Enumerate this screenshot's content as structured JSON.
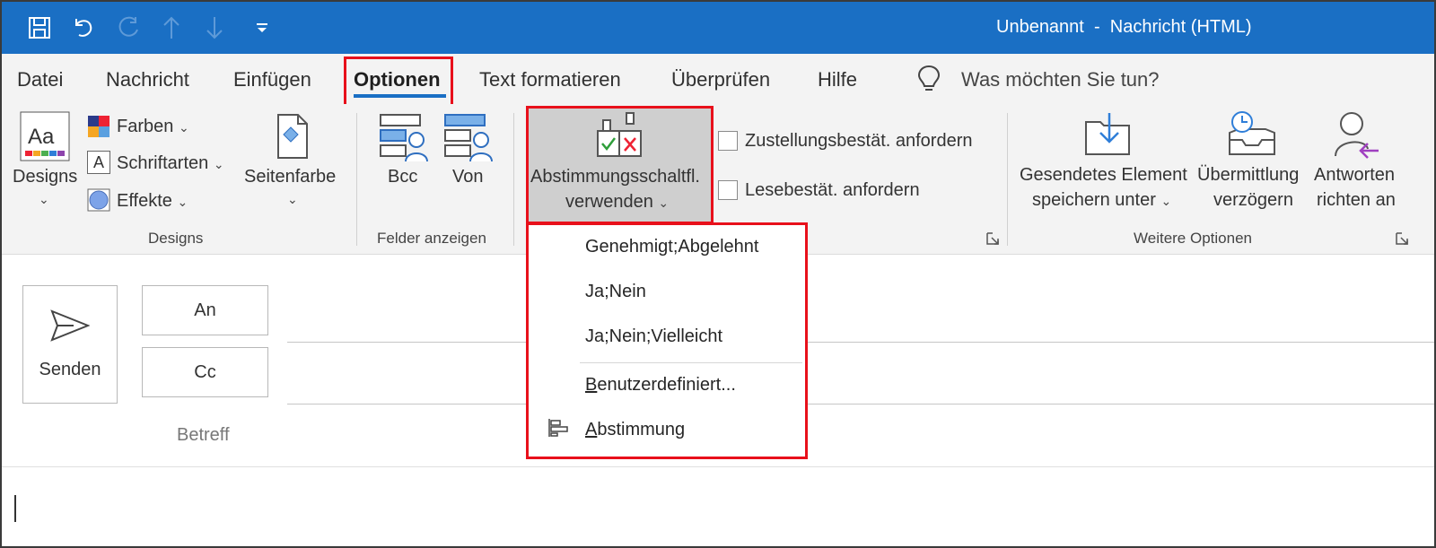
{
  "window": {
    "title": "Unbenannt  -  Nachricht (HTML)"
  },
  "quick_access": [
    {
      "name": "save-icon"
    },
    {
      "name": "undo-icon"
    },
    {
      "name": "redo-icon"
    },
    {
      "name": "previous-item-icon"
    },
    {
      "name": "next-item-icon"
    },
    {
      "name": "customize-toolbar-icon"
    }
  ],
  "tabs": {
    "datei": "Datei",
    "nachricht": "Nachricht",
    "einfuegen": "Einfügen",
    "optionen": "Optionen",
    "text_formatieren": "Text formatieren",
    "ueberpruefen": "Überprüfen",
    "hilfe": "Hilfe",
    "search_prompt": "Was möchten Sie tun?"
  },
  "ribbon": {
    "designs_group": {
      "designs": "Designs",
      "farben": "Farben",
      "schriftarten": "Schriftarten",
      "effekte": "Effekte",
      "seitenfarbe": "Seitenfarbe",
      "label": "Designs"
    },
    "felder_group": {
      "bcc": "Bcc",
      "von": "Von",
      "label": "Felder anzeigen"
    },
    "tracking_group": {
      "abstimmung_line1": "Abstimmungsschaltfl.",
      "abstimmung_line2": "verwenden",
      "zustellung": "Zustellungsbestät. anfordern",
      "lesebestaet": "Lesebestät. anfordern"
    },
    "weitere_group": {
      "gesendet_line1": "Gesendetes Element",
      "gesendet_line2": "speichern unter",
      "uebermittlung_line1": "Übermittlung",
      "uebermittlung_line2": "verzögern",
      "antworten_line1": "Antworten",
      "antworten_line2": "richten an",
      "label": "Weitere Optionen"
    }
  },
  "compose": {
    "senden": "Senden",
    "an": "An",
    "cc": "Cc",
    "betreff": "Betreff"
  },
  "dropdown": {
    "items": [
      "Genehmigt;Abgelehnt",
      "Ja;Nein",
      "Ja;Nein;Vielleicht"
    ],
    "benutzerdefiniert_first": "B",
    "benutzerdefiniert_rest": "enutzerdefiniert...",
    "abstimmung_first": "A",
    "abstimmung_rest": "bstimmung"
  },
  "colors": {
    "titlebar": "#1a6fc4",
    "accent": "#1a6fc4",
    "highlight_box": "#e8101b",
    "ribbon_bg": "#f3f3f3"
  }
}
